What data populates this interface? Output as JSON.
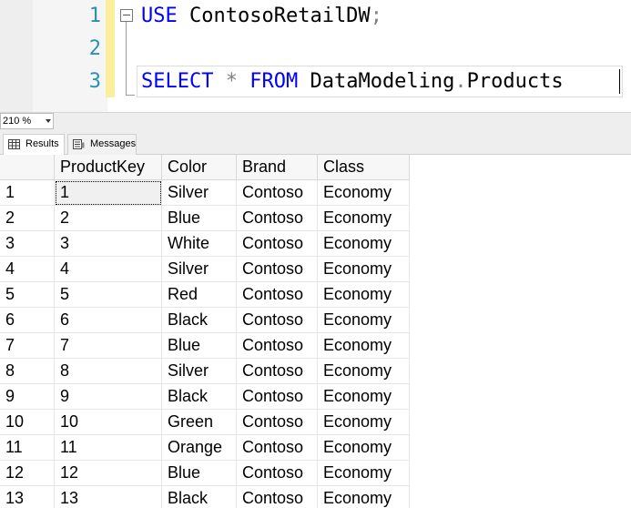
{
  "editor": {
    "line_numbers": [
      "1",
      "2",
      "3"
    ],
    "line1": {
      "kw": "USE",
      "rest": "ContosoRetailDW",
      "semi": ";"
    },
    "line3": {
      "kw_select": "SELECT",
      "star": "*",
      "kw_from": "FROM",
      "schema": "DataModeling",
      "dot": ".",
      "table": "Products"
    }
  },
  "zoom": {
    "value": "210 %"
  },
  "tabs": [
    {
      "label": "Results",
      "active": true,
      "icon": "grid-icon"
    },
    {
      "label": "Messages",
      "active": false,
      "icon": "messages-icon"
    }
  ],
  "grid": {
    "columns": [
      "",
      "ProductKey",
      "Color",
      "Brand",
      "Class"
    ],
    "rows": [
      [
        "1",
        "1",
        "Silver",
        "Contoso",
        "Economy"
      ],
      [
        "2",
        "2",
        "Blue",
        "Contoso",
        "Economy"
      ],
      [
        "3",
        "3",
        "White",
        "Contoso",
        "Economy"
      ],
      [
        "4",
        "4",
        "Silver",
        "Contoso",
        "Economy"
      ],
      [
        "5",
        "5",
        "Red",
        "Contoso",
        "Economy"
      ],
      [
        "6",
        "6",
        "Black",
        "Contoso",
        "Economy"
      ],
      [
        "7",
        "7",
        "Blue",
        "Contoso",
        "Economy"
      ],
      [
        "8",
        "8",
        "Silver",
        "Contoso",
        "Economy"
      ],
      [
        "9",
        "9",
        "Black",
        "Contoso",
        "Economy"
      ],
      [
        "10",
        "10",
        "Green",
        "Contoso",
        "Economy"
      ],
      [
        "11",
        "11",
        "Orange",
        "Contoso",
        "Economy"
      ],
      [
        "12",
        "12",
        "Blue",
        "Contoso",
        "Economy"
      ],
      [
        "13",
        "13",
        "Black",
        "Contoso",
        "Economy"
      ]
    ]
  },
  "colors": {
    "keyword": "#0000ff",
    "line_number": "#2b91af",
    "operator": "#808080",
    "changebar": "#fcef9c"
  }
}
